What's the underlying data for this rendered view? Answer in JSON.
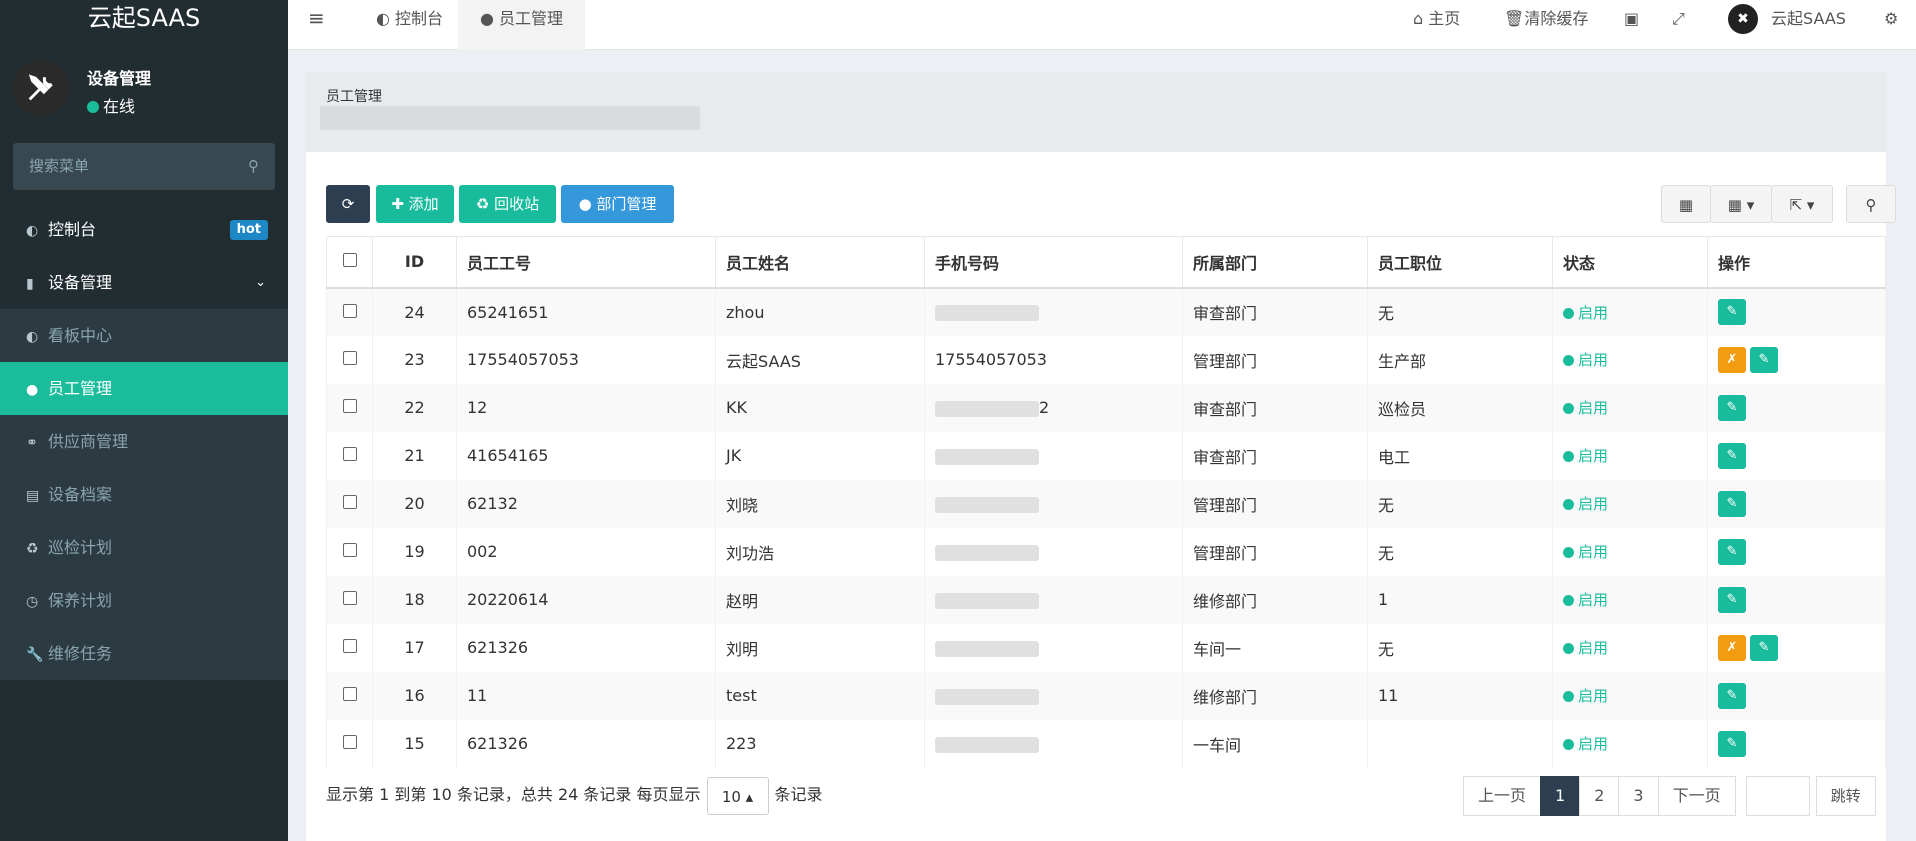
{
  "brand": "云起SAAS",
  "user": {
    "name": "设备管理",
    "status": "在线"
  },
  "search": {
    "placeholder": "搜索菜单"
  },
  "menu": {
    "dashboard": "控制台",
    "hot": "hot",
    "device_mgmt": "设备管理",
    "items": [
      "看板中心",
      "员工管理",
      "供应商管理",
      "设备档案",
      "巡检计划",
      "保养计划",
      "维修任务"
    ]
  },
  "tabs": [
    "控制台",
    "员工管理"
  ],
  "topbar": {
    "home": "主页",
    "clear_cache": "清除缓存",
    "user": "云起SAAS"
  },
  "content": {
    "title": "员工管理"
  },
  "toolbar": {
    "add": "添加",
    "recycle": "回收站",
    "dept": "部门管理"
  },
  "table": {
    "headers": [
      "ID",
      "员工工号",
      "员工姓名",
      "手机号码",
      "所属部门",
      "员工职位",
      "状态",
      "操作"
    ],
    "rows": [
      {
        "id": "24",
        "no": "65241651",
        "name": "zhou",
        "phone": "",
        "dept": "审查部门",
        "pos": "无",
        "status": "启用",
        "actions": 1
      },
      {
        "id": "23",
        "no": "17554057053",
        "name": "云起SAAS",
        "phone": "17554057053",
        "dept": "管理部门",
        "pos": "生产部",
        "status": "启用",
        "actions": 2
      },
      {
        "id": "22",
        "no": "12",
        "name": "KK",
        "phone": "2",
        "dept": "审查部门",
        "pos": "巡检员",
        "status": "启用",
        "actions": 1
      },
      {
        "id": "21",
        "no": "41654165",
        "name": "JK",
        "phone": "",
        "dept": "审查部门",
        "pos": "电工",
        "status": "启用",
        "actions": 1
      },
      {
        "id": "20",
        "no": "62132",
        "name": "刘晓",
        "phone": "",
        "dept": "管理部门",
        "pos": "无",
        "status": "启用",
        "actions": 1
      },
      {
        "id": "19",
        "no": "002",
        "name": "刘功浩",
        "phone": "",
        "dept": "管理部门",
        "pos": "无",
        "status": "启用",
        "actions": 1
      },
      {
        "id": "18",
        "no": "20220614",
        "name": "赵明",
        "phone": "",
        "dept": "维修部门",
        "pos": "1",
        "status": "启用",
        "actions": 1
      },
      {
        "id": "17",
        "no": "621326",
        "name": "刘明",
        "phone": "",
        "dept": "车间一",
        "pos": "无",
        "status": "启用",
        "actions": 2
      },
      {
        "id": "16",
        "no": "11",
        "name": "test",
        "phone": "",
        "dept": "维修部门",
        "pos": "11",
        "status": "启用",
        "actions": 1
      },
      {
        "id": "15",
        "no": "621326",
        "name": "223",
        "phone": "",
        "dept": "一车间",
        "pos": "",
        "status": "启用",
        "actions": 1
      }
    ]
  },
  "footer": {
    "summary": "显示第 1 到第 10 条记录，总共 24 条记录 每页显示",
    "page_size": "10",
    "suffix": "条记录"
  },
  "pager": {
    "prev": "上一页",
    "pages": [
      "1",
      "2",
      "3"
    ],
    "next": "下一页",
    "jump": "跳转"
  }
}
